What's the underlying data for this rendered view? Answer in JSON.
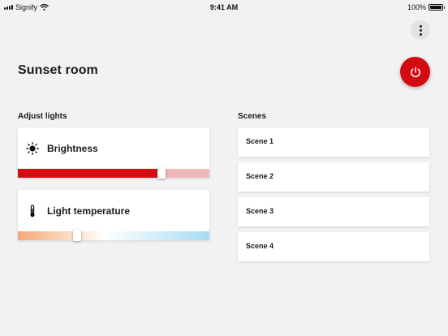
{
  "status_bar": {
    "carrier": "Signify",
    "time": "9:41 AM",
    "battery": "100%"
  },
  "header": {
    "title": "Sunset room",
    "more_icon": "more-vertical-icon",
    "power_icon": "power-icon"
  },
  "adjust_lights": {
    "heading": "Adjust lights",
    "brightness": {
      "label": "Brightness",
      "icon": "sun-icon",
      "level_percent": 75,
      "color": "#d40c12"
    },
    "temperature": {
      "label": "Light temperature",
      "icon": "thermometer-icon",
      "level_percent": 31
    }
  },
  "scenes": {
    "heading": "Scenes",
    "items": [
      {
        "label": "Scene 1"
      },
      {
        "label": "Scene 2"
      },
      {
        "label": "Scene 3"
      },
      {
        "label": "Scene 4"
      }
    ]
  },
  "colors": {
    "accent": "#d40c12",
    "background": "#f2f2f2"
  }
}
